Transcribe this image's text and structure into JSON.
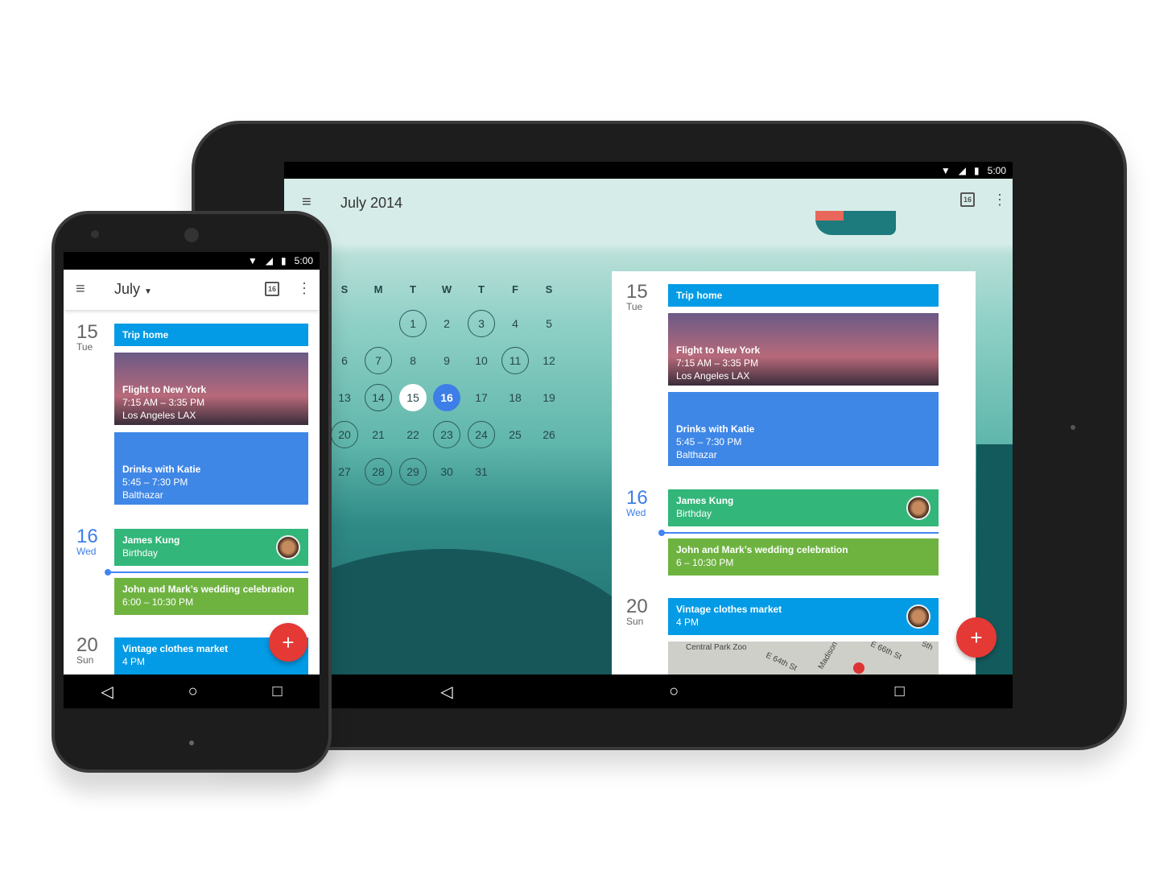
{
  "status": {
    "time": "5:00",
    "icons": [
      "wifi-icon",
      "signal-icon",
      "battery-icon"
    ]
  },
  "tablet": {
    "title": "July 2014",
    "today_icon_number": "16",
    "weekdays": [
      "S",
      "M",
      "T",
      "W",
      "T",
      "F",
      "S"
    ],
    "weeks": [
      [
        "",
        "",
        "1",
        "2",
        "3",
        "4",
        "5"
      ],
      [
        "6",
        "7",
        "8",
        "9",
        "10",
        "11",
        "12"
      ],
      [
        "13",
        "14",
        "15",
        "16",
        "17",
        "18",
        "19"
      ],
      [
        "20",
        "21",
        "22",
        "23",
        "24",
        "25",
        "26"
      ],
      [
        "27",
        "28",
        "29",
        "30",
        "31",
        "",
        ""
      ]
    ],
    "days_with_events": [
      "1",
      "3",
      "7",
      "11",
      "14",
      "20",
      "23",
      "24",
      "28",
      "29"
    ],
    "selected_day": "15",
    "today": "16",
    "map_labels": [
      "Central Park Zoo",
      "E 64th St",
      "Madison",
      "E 66th St",
      "5th"
    ]
  },
  "phone": {
    "title": "July",
    "today_icon_number": "16"
  },
  "agenda": [
    {
      "date": "15",
      "weekday": "Tue",
      "events": [
        {
          "title": "Trip home",
          "lines": []
        },
        {
          "title": "Flight to New York",
          "lines": [
            "7:15 AM – 3:35 PM",
            "Los Angeles LAX"
          ]
        },
        {
          "title": "Drinks with Katie",
          "lines": [
            "5:45 – 7:30 PM",
            "Balthazar"
          ]
        }
      ]
    },
    {
      "date": "16",
      "weekday": "Wed",
      "events": [
        {
          "title": "James Kung",
          "lines": [
            "Birthday"
          ]
        },
        {
          "title": "John and Mark’s wedding celebration",
          "lines": [
            "6 – 10:30 PM"
          ]
        }
      ]
    },
    {
      "date": "20",
      "weekday": "Sun",
      "events": [
        {
          "title": "Vintage clothes market",
          "lines": [
            "4 PM"
          ]
        }
      ]
    }
  ],
  "phone_wedding_time": "6:00 – 10:30 PM",
  "fab_label": "+",
  "colors": {
    "trip": "#039be5",
    "birthday": "#33b679",
    "wedding": "#6eb340",
    "drinks": "#3f87e6",
    "fab": "#e53935",
    "today": "#3d7ee8"
  }
}
